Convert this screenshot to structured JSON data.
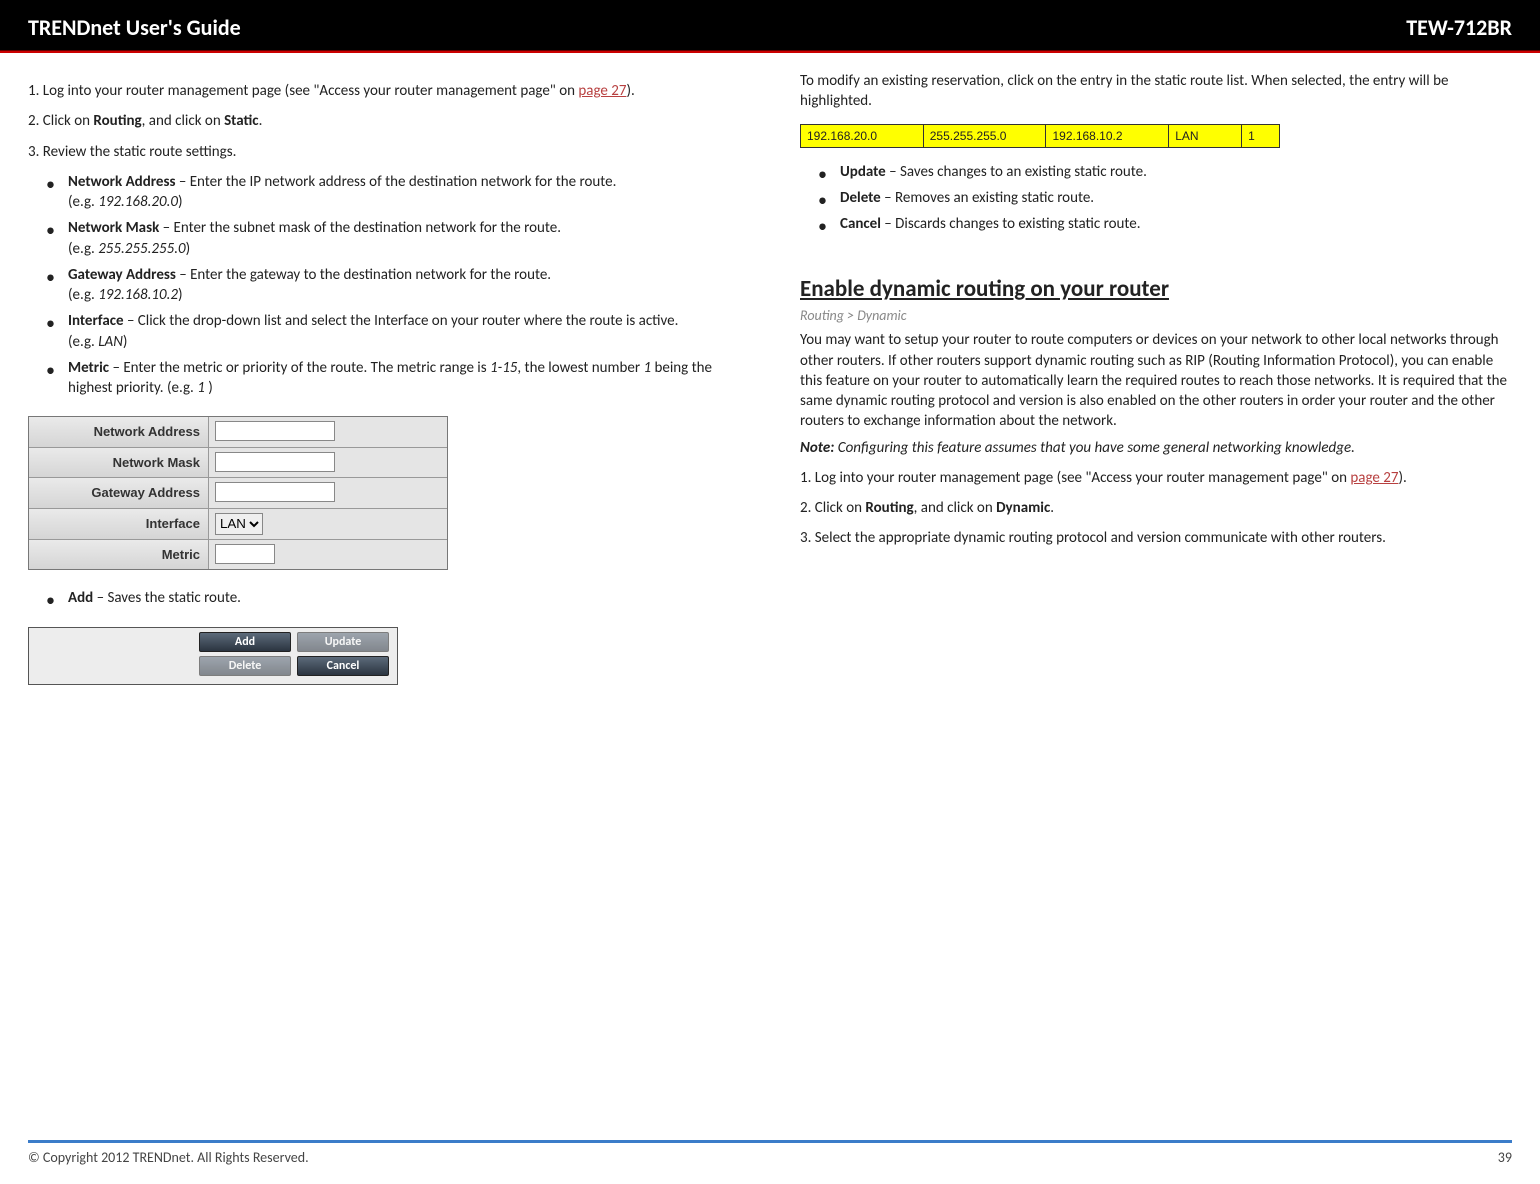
{
  "header": {
    "title": "TRENDnet User's Guide",
    "model": "TEW-712BR"
  },
  "left": {
    "step1_a": "1. Log into your router management page (see \"Access your router management page\" on ",
    "step1_link": "page 27",
    "step1_b": ").",
    "step2_a": "2. Click on ",
    "step2_b1": "Routing",
    "step2_c": ", and click on ",
    "step2_b2": "Static",
    "step2_d": ".",
    "step3": "3. Review the static route settings.",
    "bullets": [
      {
        "b": "Network Address",
        "t": " – Enter the IP network address of the destination network for the route.",
        "eg": "(e.g. ",
        "egv": "192.168.20.0",
        "egc": ")"
      },
      {
        "b": "Network Mask",
        "t": " – Enter the subnet mask of the destination network for the route.",
        "eg": "(e.g. ",
        "egv": "255.255.255.0",
        "egc": ")"
      },
      {
        "b": "Gateway Address",
        "t": " – Enter the gateway to the destination network for the route.",
        "eg": "(e.g. ",
        "egv": "192.168.10.2",
        "egc": ")"
      },
      {
        "b": "Interface",
        "t": " – Click the drop-down list and select the Interface on your router where the route is active.",
        "eg": "(e.g. ",
        "egv": "LAN",
        "egc": ")"
      },
      {
        "b": "Metric",
        "t": " – Enter the metric or priority of the route. The metric range is ",
        "r": "1-15",
        "t2": ", the lowest number ",
        "r2": "1",
        "t3": " being the highest priority. (e.g. ",
        "r3": "1",
        "t4": " )"
      }
    ],
    "form_labels": [
      "Network Address",
      "Network Mask",
      "Gateway Address",
      "Interface",
      "Metric"
    ],
    "interface_option": "LAN",
    "add_bullet_b": "Add",
    "add_bullet_t": " – Saves the static route.",
    "buttons": [
      "Add",
      "Update",
      "Delete",
      "Cancel"
    ]
  },
  "right": {
    "intro": "To modify an existing reservation, click on the entry in the static route list. When selected, the entry will be highlighted.",
    "hl_row": [
      "192.168.20.0",
      "255.255.255.0",
      "192.168.10.2",
      "LAN",
      "1"
    ],
    "bullets2": [
      {
        "b": "Update",
        "t": " – Saves changes to an existing static route."
      },
      {
        "b": "Delete",
        "t": " – Removes an existing static route."
      },
      {
        "b": "Cancel",
        "t": " – Discards changes to existing static route."
      }
    ],
    "h2": "Enable dynamic routing on your router",
    "breadcrumb": "Routing > Dynamic",
    "para": "You may want to setup your router to route computers or devices on your network to other local networks through other routers. If other routers support dynamic routing such as RIP (Routing Information Protocol), you can enable this feature on your router to automatically learn the required routes to reach those networks. It is required that the same dynamic routing protocol and version is also enabled on the other routers in order your router and the other routers to exchange information about the network.",
    "note_b": "Note:",
    "note_t": " Configuring this feature assumes that you have some general networking knowledge.",
    "dstep1_a": "1. Log into your router management page (see \"Access your router management page\" on ",
    "dstep1_link": "page 27",
    "dstep1_b": ").",
    "dstep2_a": "2. Click on ",
    "dstep2_b1": "Routing",
    "dstep2_c": ", and click on ",
    "dstep2_b2": "Dynamic",
    "dstep2_d": ".",
    "dstep3": "3. Select the appropriate dynamic routing protocol and version communicate with other routers."
  },
  "footer": {
    "copyright": "© Copyright 2012 TRENDnet. All Rights Reserved.",
    "page": "39"
  }
}
